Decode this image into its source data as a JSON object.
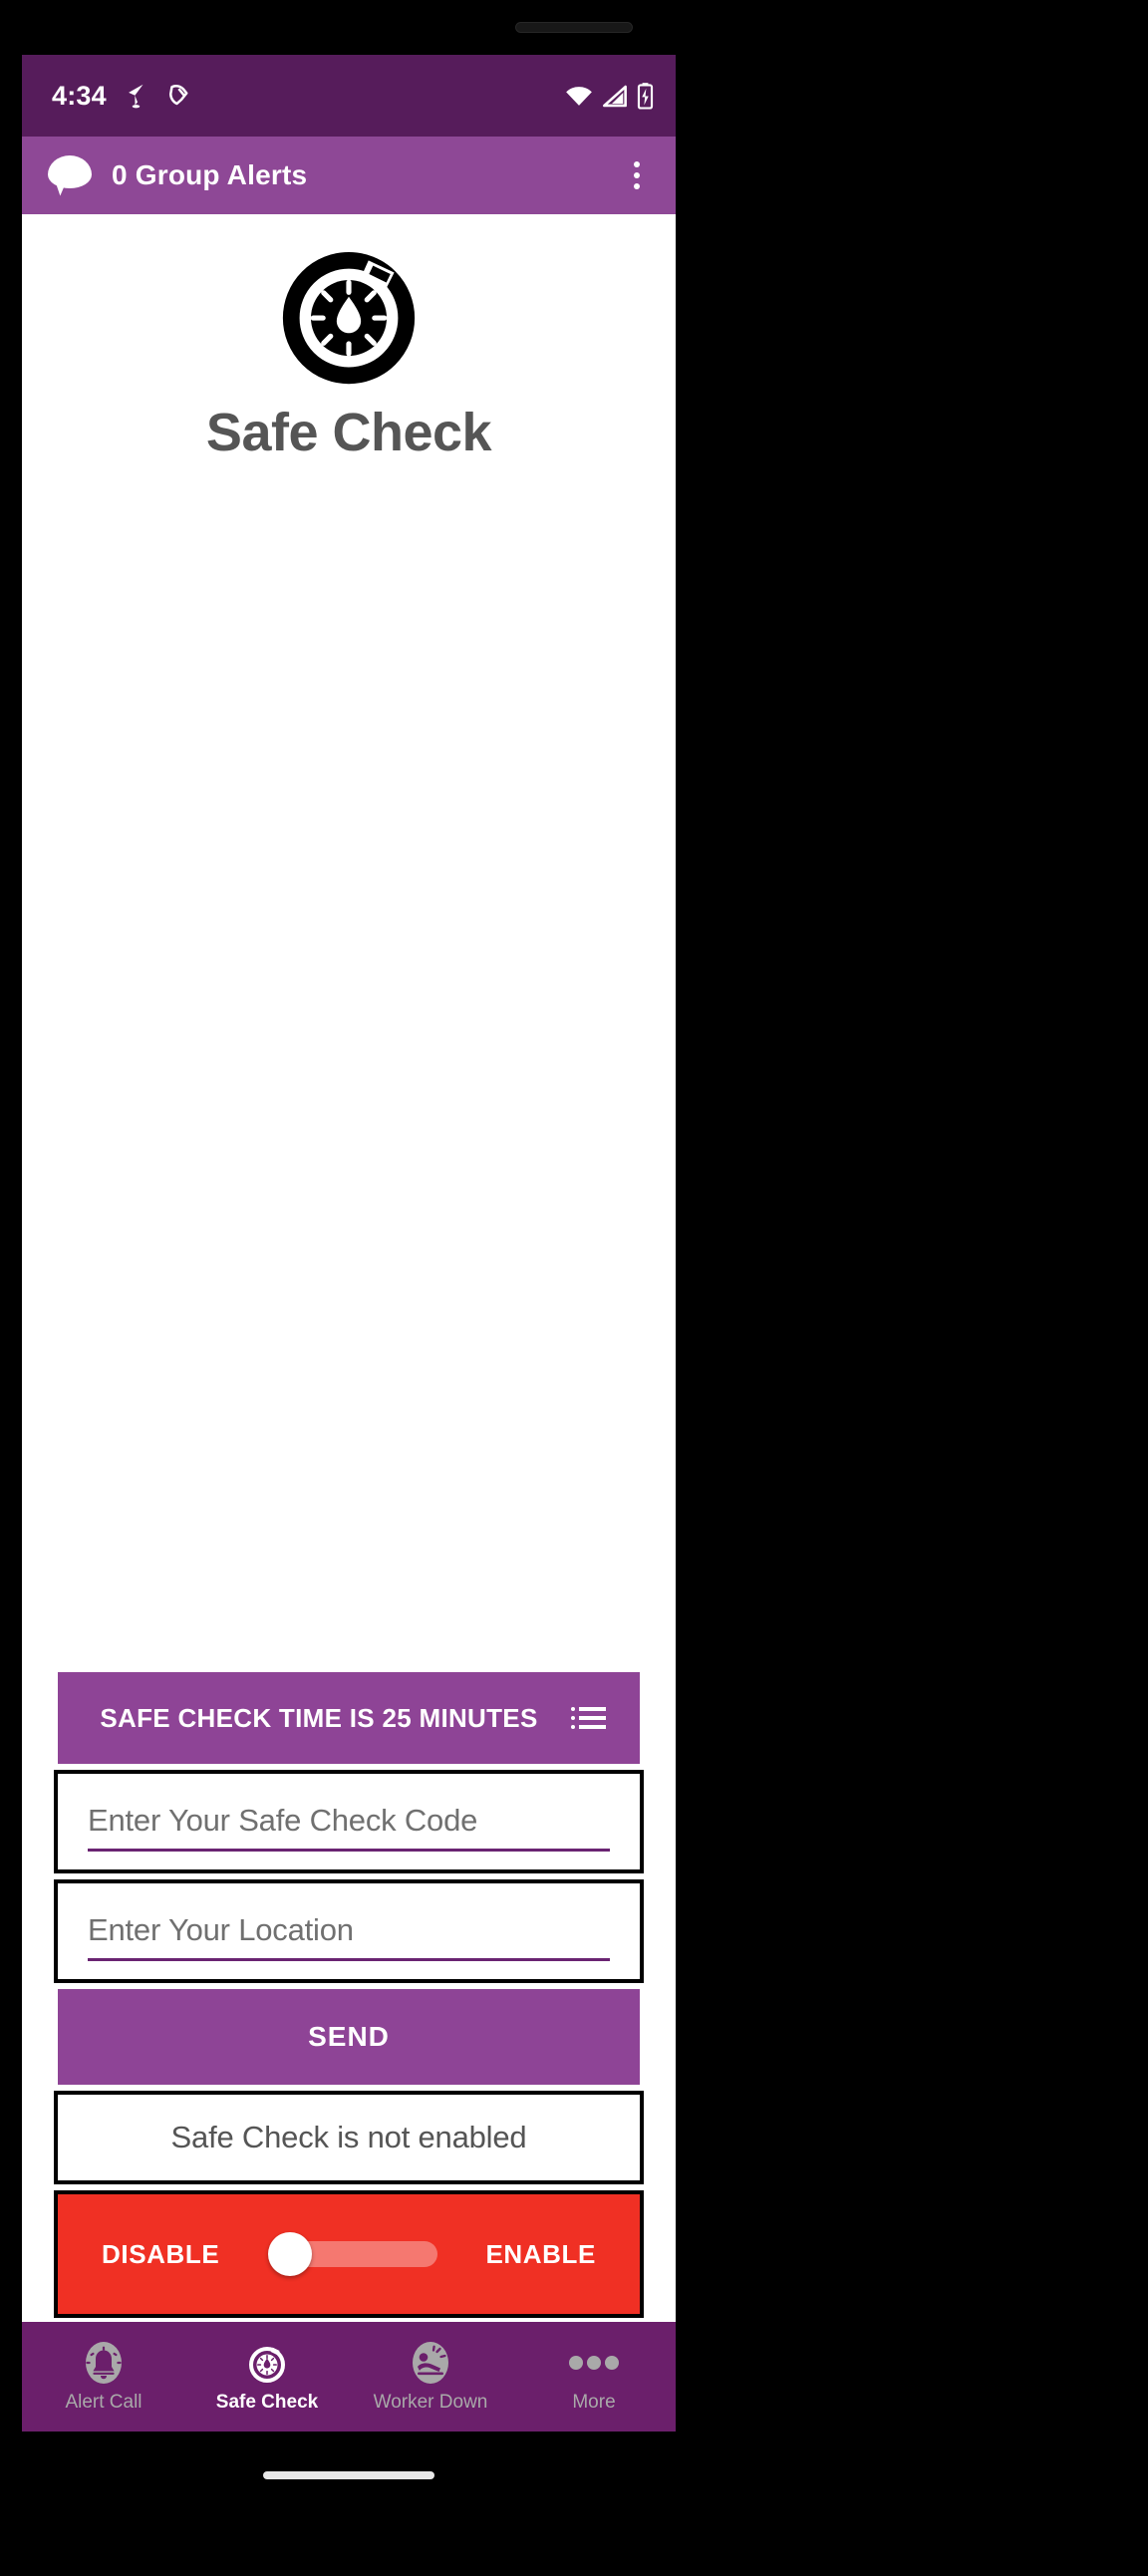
{
  "status_bar": {
    "time": "4:34",
    "left_icons": [
      "location-off-icon",
      "mute-alerts-icon"
    ],
    "right_icons": [
      "wifi-icon",
      "cellular-signal-icon",
      "battery-charging-icon"
    ],
    "background_color": "#561C5B"
  },
  "app_bar": {
    "icon": "chat-bubble-icon",
    "title": "0 Group Alerts",
    "overflow_icon": "more-vertical-icon",
    "background_color": "#8E4896"
  },
  "hero": {
    "logo_icon": "safe-check-stopwatch-icon",
    "title": "Safe Check",
    "title_color": "#555555"
  },
  "form": {
    "time_bar": {
      "label": "SAFE CHECK TIME IS 25 MINUTES",
      "minutes": "25",
      "menu_icon": "list-menu-icon",
      "background_color": "#8E4496"
    },
    "code_field": {
      "placeholder": "Enter Your Safe Check Code",
      "value": ""
    },
    "location_field": {
      "placeholder": "Enter Your Location",
      "value": ""
    },
    "send_button": {
      "label": "SEND",
      "background_color": "#8E4496"
    },
    "status_box": {
      "label": "Safe Check is not enabled"
    },
    "toggle": {
      "left_label": "DISABLE",
      "right_label": "ENABLE",
      "state": "disabled",
      "background_color": "#F03024"
    }
  },
  "bottom_nav": {
    "background_color": "#6B1F6B",
    "items": [
      {
        "label": "Alert Call",
        "icon": "alert-bell-icon",
        "active": false
      },
      {
        "label": "Safe Check",
        "icon": "stopwatch-icon",
        "active": true
      },
      {
        "label": "Worker Down",
        "icon": "worker-down-icon",
        "active": false
      },
      {
        "label": "More",
        "icon": "more-horizontal-icon",
        "active": false
      }
    ]
  }
}
